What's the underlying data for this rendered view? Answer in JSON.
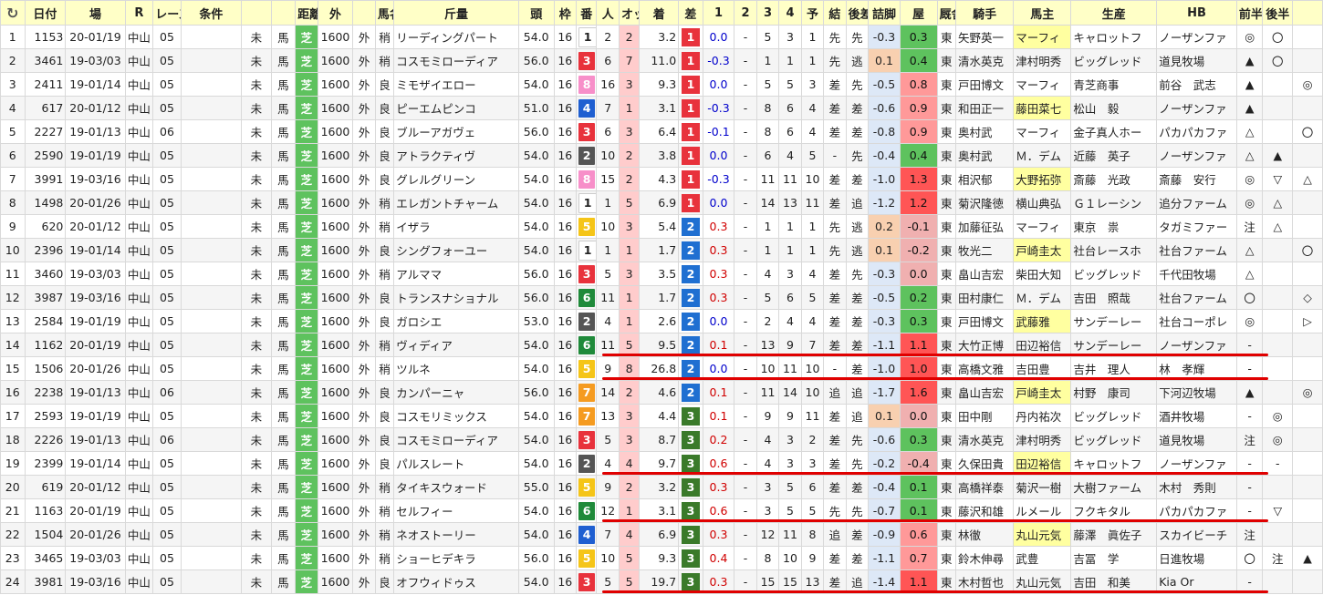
{
  "columns": [
    "↻",
    "日付",
    "場",
    "R",
    "レース名",
    "条件",
    "",
    "",
    "距離",
    "外",
    "",
    "馬名",
    "斤量",
    "頭",
    "枠",
    "番",
    "人",
    "オッズ",
    "着",
    "差",
    "1",
    "2",
    "3",
    "4",
    "予",
    "結",
    "後差",
    "詰脚",
    "屋",
    "厩舎",
    "騎手",
    "馬主",
    "生産",
    "HB",
    "前半",
    "後半"
  ],
  "rows": [
    [
      "1",
      "1153",
      "20-01/19",
      "中山",
      "05",
      "",
      "未",
      "馬",
      "芝",
      "1600",
      "外",
      "稍",
      "リーディングパート",
      "54.0",
      "16",
      "1",
      "2",
      "2",
      "3.2",
      "1",
      "0.0",
      "-",
      "5",
      "3",
      "1",
      "先",
      "先",
      "-0.3",
      "0.3",
      "東",
      "矢野英一",
      "マーフィ",
      "キャロットフ",
      "ノーザンファ",
      "◎",
      "〇",
      ""
    ],
    [
      "2",
      "3461",
      "19-03/03",
      "中山",
      "05",
      "",
      "未",
      "馬",
      "芝",
      "1600",
      "外",
      "稍",
      "コスモミローディア",
      "56.0",
      "16",
      "3",
      "6",
      "7",
      "11.0",
      "1",
      "-0.3",
      "-",
      "1",
      "1",
      "1",
      "先",
      "逃",
      "0.1",
      "0.4",
      "東",
      "清水英克",
      "津村明秀",
      "ビッグレッド",
      "道見牧場",
      "▲",
      "〇",
      ""
    ],
    [
      "3",
      "2411",
      "19-01/14",
      "中山",
      "05",
      "",
      "未",
      "馬",
      "芝",
      "1600",
      "外",
      "良",
      "ミモザイエロー",
      "54.0",
      "16",
      "8",
      "16",
      "3",
      "9.3",
      "1",
      "0.0",
      "-",
      "5",
      "5",
      "3",
      "差",
      "先",
      "-0.5",
      "0.8",
      "東",
      "戸田博文",
      "マーフィ",
      "青芝商事",
      "前谷　武志",
      "▲",
      "",
      "◎"
    ],
    [
      "4",
      "617",
      "20-01/12",
      "中山",
      "05",
      "",
      "未",
      "馬",
      "芝",
      "1600",
      "外",
      "良",
      "ピーエムピンコ",
      "51.0",
      "16",
      "4",
      "7",
      "1",
      "3.1",
      "1",
      "-0.3",
      "-",
      "8",
      "6",
      "4",
      "差",
      "差",
      "-0.6",
      "0.9",
      "東",
      "和田正一",
      "藤田菜七",
      "松山　毅",
      "ノーザンファ",
      "▲",
      "",
      ""
    ],
    [
      "5",
      "2227",
      "19-01/13",
      "中山",
      "06",
      "",
      "未",
      "馬",
      "芝",
      "1600",
      "外",
      "良",
      "ブルーアガヴェ",
      "56.0",
      "16",
      "3",
      "6",
      "3",
      "6.4",
      "1",
      "-0.1",
      "-",
      "8",
      "6",
      "4",
      "差",
      "差",
      "-0.8",
      "0.9",
      "東",
      "奥村武",
      "マーフィ",
      "金子真人ホー",
      "パカパカファ",
      "△",
      "",
      "〇"
    ],
    [
      "6",
      "2590",
      "19-01/19",
      "中山",
      "05",
      "",
      "未",
      "馬",
      "芝",
      "1600",
      "外",
      "良",
      "アトラクティヴ",
      "54.0",
      "16",
      "2",
      "10",
      "2",
      "3.8",
      "1",
      "0.0",
      "-",
      "6",
      "4",
      "5",
      "-",
      "先",
      "-0.4",
      "0.4",
      "東",
      "奥村武",
      "Ｍ．デム",
      "近藤　英子",
      "ノーザンファ",
      "△",
      "▲",
      ""
    ],
    [
      "7",
      "3991",
      "19-03/16",
      "中山",
      "05",
      "",
      "未",
      "馬",
      "芝",
      "1600",
      "外",
      "良",
      "グレルグリーン",
      "54.0",
      "16",
      "8",
      "15",
      "2",
      "4.3",
      "1",
      "-0.3",
      "-",
      "11",
      "11",
      "10",
      "差",
      "差",
      "-1.0",
      "1.3",
      "東",
      "相沢郁",
      "大野拓弥",
      "斎藤　光政",
      "斎藤　安行",
      "◎",
      "▽",
      "△"
    ],
    [
      "8",
      "1498",
      "20-01/26",
      "中山",
      "05",
      "",
      "未",
      "馬",
      "芝",
      "1600",
      "外",
      "稍",
      "エレガントチャーム",
      "54.0",
      "16",
      "1",
      "1",
      "5",
      "6.9",
      "1",
      "0.0",
      "-",
      "14",
      "13",
      "11",
      "差",
      "追",
      "-1.2",
      "1.2",
      "東",
      "菊沢隆徳",
      "横山典弘",
      "Ｇ１レーシン",
      "追分ファーム",
      "◎",
      "△",
      ""
    ],
    [
      "9",
      "620",
      "20-01/12",
      "中山",
      "05",
      "",
      "未",
      "馬",
      "芝",
      "1600",
      "外",
      "稍",
      "イザラ",
      "54.0",
      "16",
      "5",
      "10",
      "3",
      "5.4",
      "2",
      "0.3",
      "-",
      "1",
      "1",
      "1",
      "先",
      "逃",
      "0.2",
      "-0.1",
      "東",
      "加藤征弘",
      "マーフィ",
      "東京　祟",
      "タガミファー",
      "注",
      "△",
      ""
    ],
    [
      "10",
      "2396",
      "19-01/14",
      "中山",
      "05",
      "",
      "未",
      "馬",
      "芝",
      "1600",
      "外",
      "良",
      "シングフォーユー",
      "54.0",
      "16",
      "1",
      "1",
      "1",
      "1.7",
      "2",
      "0.3",
      "-",
      "1",
      "1",
      "1",
      "先",
      "逃",
      "0.1",
      "-0.2",
      "東",
      "牧光二",
      "戸崎圭太",
      "社台レースホ",
      "社台ファーム",
      "△",
      "",
      "〇"
    ],
    [
      "11",
      "3460",
      "19-03/03",
      "中山",
      "05",
      "",
      "未",
      "馬",
      "芝",
      "1600",
      "外",
      "稍",
      "アルママ",
      "56.0",
      "16",
      "3",
      "5",
      "3",
      "3.5",
      "2",
      "0.3",
      "-",
      "4",
      "3",
      "4",
      "差",
      "先",
      "-0.3",
      "0.0",
      "東",
      "畠山吉宏",
      "柴田大知",
      "ビッグレッド",
      "千代田牧場",
      "△",
      "",
      ""
    ],
    [
      "12",
      "3987",
      "19-03/16",
      "中山",
      "05",
      "",
      "未",
      "馬",
      "芝",
      "1600",
      "外",
      "良",
      "トランスナショナル",
      "56.0",
      "16",
      "6",
      "11",
      "1",
      "1.7",
      "2",
      "0.3",
      "-",
      "5",
      "6",
      "5",
      "差",
      "差",
      "-0.5",
      "0.2",
      "東",
      "田村康仁",
      "Ｍ．デム",
      "吉田　照哉",
      "社台ファーム",
      "〇",
      "",
      "◇"
    ],
    [
      "13",
      "2584",
      "19-01/19",
      "中山",
      "05",
      "",
      "未",
      "馬",
      "芝",
      "1600",
      "外",
      "良",
      "ガロシエ",
      "53.0",
      "16",
      "2",
      "4",
      "1",
      "2.6",
      "2",
      "0.0",
      "-",
      "2",
      "4",
      "4",
      "差",
      "差",
      "-0.3",
      "0.3",
      "東",
      "戸田博文",
      "武藤雅",
      "サンデーレー",
      "社台コーポレ",
      "◎",
      "",
      "▷"
    ],
    [
      "14",
      "1162",
      "20-01/19",
      "中山",
      "05",
      "",
      "未",
      "馬",
      "芝",
      "1600",
      "外",
      "稍",
      "ヴィディア",
      "54.0",
      "16",
      "6",
      "11",
      "5",
      "9.5",
      "2",
      "0.1",
      "-",
      "13",
      "9",
      "7",
      "差",
      "差",
      "-1.1",
      "1.1",
      "東",
      "大竹正博",
      "田辺裕信",
      "サンデーレー",
      "ノーザンファ",
      "-",
      "",
      ""
    ],
    [
      "15",
      "1506",
      "20-01/26",
      "中山",
      "05",
      "",
      "未",
      "馬",
      "芝",
      "1600",
      "外",
      "稍",
      "ツルネ",
      "54.0",
      "16",
      "5",
      "9",
      "8",
      "26.8",
      "2",
      "0.0",
      "-",
      "10",
      "11",
      "10",
      "-",
      "差",
      "-1.0",
      "1.0",
      "東",
      "高橋文雅",
      "吉田豊",
      "吉井　理人",
      "林　孝輝",
      "-",
      "",
      ""
    ],
    [
      "16",
      "2238",
      "19-01/13",
      "中山",
      "06",
      "",
      "未",
      "馬",
      "芝",
      "1600",
      "外",
      "良",
      "カンパーニャ",
      "56.0",
      "16",
      "7",
      "14",
      "2",
      "4.6",
      "2",
      "0.1",
      "-",
      "11",
      "14",
      "10",
      "追",
      "追",
      "-1.7",
      "1.6",
      "東",
      "畠山吉宏",
      "戸崎圭太",
      "村野　康司",
      "下河辺牧場",
      "▲",
      "",
      "◎"
    ],
    [
      "17",
      "2593",
      "19-01/19",
      "中山",
      "05",
      "",
      "未",
      "馬",
      "芝",
      "1600",
      "外",
      "良",
      "コスモリミックス",
      "54.0",
      "16",
      "7",
      "13",
      "3",
      "4.4",
      "3",
      "0.1",
      "-",
      "9",
      "9",
      "11",
      "差",
      "追",
      "0.1",
      "0.0",
      "東",
      "田中剛",
      "丹内祐次",
      "ビッグレッド",
      "酒井牧場",
      "-",
      "◎",
      ""
    ],
    [
      "18",
      "2226",
      "19-01/13",
      "中山",
      "06",
      "",
      "未",
      "馬",
      "芝",
      "1600",
      "外",
      "良",
      "コスモミローディア",
      "54.0",
      "16",
      "3",
      "5",
      "3",
      "8.7",
      "3",
      "0.2",
      "-",
      "4",
      "3",
      "2",
      "差",
      "先",
      "-0.6",
      "0.3",
      "東",
      "清水英克",
      "津村明秀",
      "ビッグレッド",
      "道見牧場",
      "注",
      "◎",
      ""
    ],
    [
      "19",
      "2399",
      "19-01/14",
      "中山",
      "05",
      "",
      "未",
      "馬",
      "芝",
      "1600",
      "外",
      "良",
      "パルスレート",
      "54.0",
      "16",
      "2",
      "4",
      "4",
      "9.7",
      "3",
      "0.6",
      "-",
      "4",
      "3",
      "3",
      "差",
      "先",
      "-0.2",
      "-0.4",
      "東",
      "久保田貴",
      "田辺裕信",
      "キャロットフ",
      "ノーザンファ",
      "-",
      "-",
      ""
    ],
    [
      "20",
      "619",
      "20-01/12",
      "中山",
      "05",
      "",
      "未",
      "馬",
      "芝",
      "1600",
      "外",
      "稍",
      "タイキスウォード",
      "55.0",
      "16",
      "5",
      "9",
      "2",
      "3.2",
      "3",
      "0.3",
      "-",
      "3",
      "5",
      "6",
      "差",
      "差",
      "-0.4",
      "0.1",
      "東",
      "高橋祥泰",
      "菊沢一樹",
      "大樹ファーム",
      "木村　秀則",
      "-",
      "",
      ""
    ],
    [
      "21",
      "1163",
      "20-01/19",
      "中山",
      "05",
      "",
      "未",
      "馬",
      "芝",
      "1600",
      "外",
      "稍",
      "セルフィー",
      "54.0",
      "16",
      "6",
      "12",
      "1",
      "3.1",
      "3",
      "0.6",
      "-",
      "3",
      "5",
      "5",
      "先",
      "先",
      "-0.7",
      "0.1",
      "東",
      "藤沢和雄",
      "ルメール",
      "フクキタル",
      "パカパカファ",
      "-",
      "▽",
      ""
    ],
    [
      "22",
      "1504",
      "20-01/26",
      "中山",
      "05",
      "",
      "未",
      "馬",
      "芝",
      "1600",
      "外",
      "稍",
      "ネオストーリー",
      "54.0",
      "16",
      "4",
      "7",
      "4",
      "6.9",
      "3",
      "0.3",
      "-",
      "12",
      "11",
      "8",
      "追",
      "差",
      "-0.9",
      "0.6",
      "東",
      "林徹",
      "丸山元気",
      "藤澤　眞佐子",
      "スカイビーチ",
      "注",
      "",
      ""
    ],
    [
      "23",
      "3465",
      "19-03/03",
      "中山",
      "05",
      "",
      "未",
      "馬",
      "芝",
      "1600",
      "外",
      "稍",
      "ショーヒデキラ",
      "56.0",
      "16",
      "5",
      "10",
      "5",
      "9.3",
      "3",
      "0.4",
      "-",
      "8",
      "10",
      "9",
      "差",
      "差",
      "-1.1",
      "0.7",
      "東",
      "鈴木伸尋",
      "武豊",
      "吉冨　学",
      "日進牧場",
      "〇",
      "注",
      "▲"
    ],
    [
      "24",
      "3981",
      "19-03/16",
      "中山",
      "05",
      "",
      "未",
      "馬",
      "芝",
      "1600",
      "外",
      "良",
      "オフウィドゥス",
      "54.0",
      "16",
      "3",
      "5",
      "5",
      "19.7",
      "3",
      "0.3",
      "-",
      "15",
      "15",
      "13",
      "差",
      "追",
      "-1.4",
      "1.1",
      "東",
      "木村哲也",
      "丸山元気",
      "吉田　和美",
      "Kia Or",
      "-",
      "",
      ""
    ]
  ],
  "colors": {
    "header_bg": "#ffffc7",
    "waku": {
      "1": "#ffffff",
      "2": "#555555",
      "3": "#e8323c",
      "4": "#1f5fd1",
      "5": "#f5c518",
      "6": "#1f8a3a",
      "7": "#f59b20",
      "8": "#f78fc9"
    },
    "pos": {
      "1": "#e8323c",
      "2": "#1f6fd1",
      "3": "#3a7a2a"
    },
    "turf": "#5ec25e",
    "redline": "#e00000"
  }
}
